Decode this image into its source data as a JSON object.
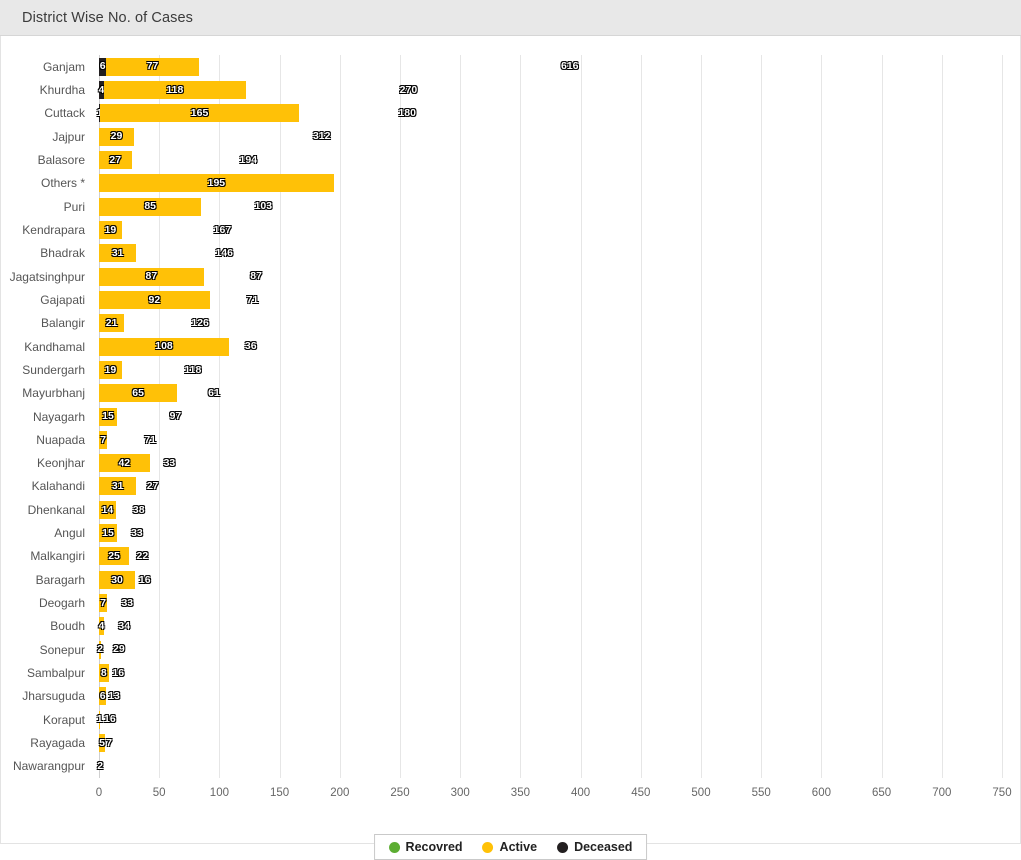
{
  "panel": {
    "title": "District Wise No. of Cases"
  },
  "legend": {
    "items": [
      {
        "label": "Recovred",
        "color": "#5cad32",
        "icon": "circle-marker-icon"
      },
      {
        "label": "Active",
        "color": "#ffc107",
        "icon": "circle-marker-icon"
      },
      {
        "label": "Deceased",
        "color": "#231f20",
        "icon": "circle-marker-icon"
      }
    ]
  },
  "chart_data": {
    "type": "bar",
    "orientation": "horizontal",
    "stacked": true,
    "title": "District Wise No. of Cases",
    "xlabel": "",
    "ylabel": "",
    "xlim": [
      0,
      750
    ],
    "xticks": [
      0,
      50,
      100,
      150,
      200,
      250,
      300,
      350,
      400,
      450,
      500,
      550,
      600,
      650,
      700,
      750
    ],
    "grid": true,
    "legend_position": "bottom",
    "series_order": [
      "Deceased",
      "Active",
      "Recovred"
    ],
    "colors": {
      "Recovred": "#5cad32",
      "Active": "#ffc107",
      "Deceased": "#231f20"
    },
    "categories": [
      "Ganjam",
      "Khurdha",
      "Cuttack",
      "Jajpur",
      "Balasore",
      "Others *",
      "Puri",
      "Kendrapara",
      "Bhadrak",
      "Jagatsinghpur",
      "Gajapati",
      "Balangir",
      "Kandhamal",
      "Sundergarh",
      "Mayurbhanj",
      "Nayagarh",
      "Nuapada",
      "Keonjhar",
      "Kalahandi",
      "Dhenkanal",
      "Angul",
      "Malkangiri",
      "Baragarh",
      "Deogarh",
      "Boudh",
      "Sonepur",
      "Sambalpur",
      "Jharsuguda",
      "Koraput",
      "Rayagada",
      "Nawarangpur"
    ],
    "series": [
      {
        "name": "Deceased",
        "values": [
          6,
          4,
          1,
          0,
          0,
          0,
          0,
          0,
          0,
          0,
          0,
          0,
          0,
          0,
          0,
          0,
          0,
          0,
          0,
          0,
          0,
          0,
          0,
          0,
          0,
          0,
          0,
          0,
          0,
          0,
          0
        ]
      },
      {
        "name": "Active",
        "values": [
          77,
          118,
          165,
          29,
          27,
          195,
          85,
          19,
          31,
          87,
          92,
          21,
          108,
          19,
          65,
          15,
          7,
          42,
          31,
          14,
          15,
          25,
          30,
          7,
          4,
          2,
          8,
          6,
          1,
          5,
          0
        ]
      },
      {
        "name": "Recovred",
        "values": [
          616,
          270,
          180,
          312,
          194,
          0,
          103,
          167,
          146,
          87,
          71,
          126,
          36,
          118,
          61,
          97,
          71,
          33,
          27,
          38,
          33,
          22,
          16,
          33,
          34,
          29,
          16,
          13,
          16,
          7,
          2
        ]
      }
    ]
  }
}
